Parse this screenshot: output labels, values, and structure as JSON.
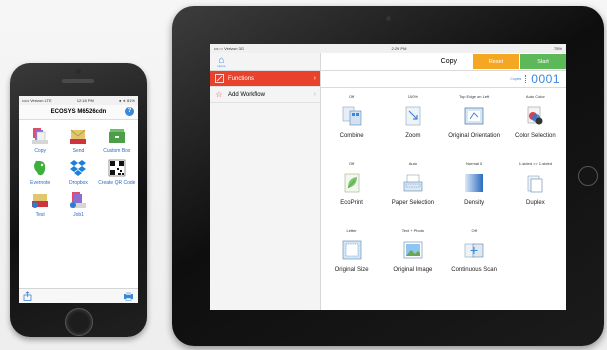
{
  "phone": {
    "status": {
      "carrier": "••••• Verizon LTE",
      "time": "12:18 PM",
      "battery": "● ∗ 81%"
    },
    "title": "ECOSYS M6526cdn",
    "help": "?",
    "apps": [
      {
        "label": "Copy"
      },
      {
        "label": "Send"
      },
      {
        "label": "Custom Box"
      },
      {
        "label": "Evernote"
      },
      {
        "label": "Dropbox"
      },
      {
        "label": "Create QR Code"
      },
      {
        "label": "Test"
      },
      {
        "label": "Job1"
      }
    ]
  },
  "ipad": {
    "status": {
      "carrier": "•••○○ Verizon  3G",
      "time": "2:29 PM",
      "battery": "75%"
    },
    "home_label": "Home",
    "sidebar": [
      {
        "label": "Functions",
        "active": true
      },
      {
        "label": "Add Workflow",
        "active": false
      }
    ],
    "topbar": {
      "title": "Copy",
      "reset": "Reset",
      "start": "Start"
    },
    "copies": {
      "label": "Copies",
      "value": "0001"
    },
    "functions": [
      {
        "value": "Off",
        "name": "Combine"
      },
      {
        "value": "100%",
        "name": "Zoom"
      },
      {
        "value": "Top Edge on Left",
        "name": "Original Orientation"
      },
      {
        "value": "Auto Color",
        "name": "Color Selection"
      },
      {
        "value": "Off",
        "name": "EcoPrint"
      },
      {
        "value": "Auto",
        "name": "Paper Selection"
      },
      {
        "value": "Normal 0",
        "name": "Density"
      },
      {
        "value": "1-sided >> 1-sided",
        "name": "Duplex"
      },
      {
        "value": "Letter",
        "name": "Original Size"
      },
      {
        "value": "Text + Photo",
        "name": "Original Image"
      },
      {
        "value": "Off",
        "name": "Continuous Scan"
      }
    ]
  }
}
